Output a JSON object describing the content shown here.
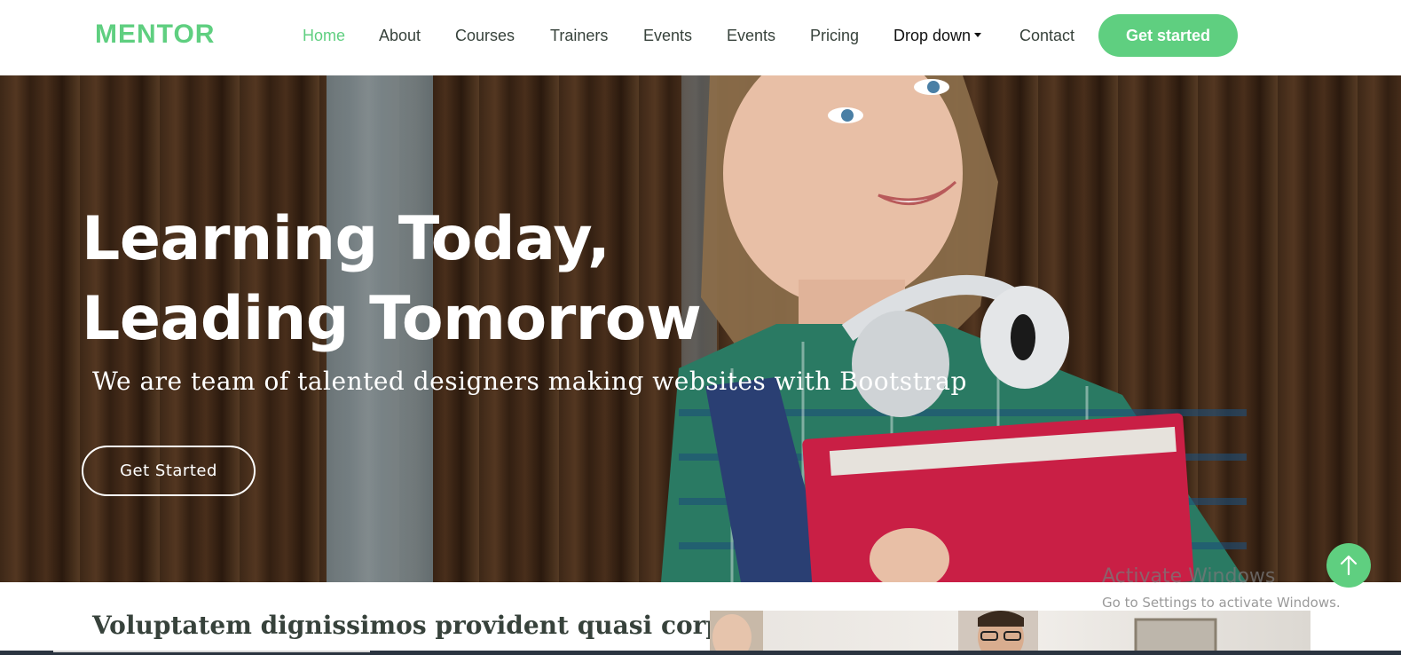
{
  "header": {
    "logo": "MENTOR",
    "nav": [
      {
        "label": "Home"
      },
      {
        "label": "About"
      },
      {
        "label": "Courses"
      },
      {
        "label": "Trainers"
      },
      {
        "label": "Events"
      },
      {
        "label": "Events"
      },
      {
        "label": "Pricing"
      },
      {
        "label": "Drop down"
      },
      {
        "label": "Contact"
      }
    ],
    "cta_label": "Get started"
  },
  "hero": {
    "title_line1": "Learning Today,",
    "title_line2": "Leading Tomorrow",
    "subtitle": "We are team of talented designers making websites with Bootstrap",
    "button_label": "Get Started"
  },
  "about": {
    "title": "Voluptatem dignissimos provident quasi corporis"
  },
  "watermark": {
    "title": "Activate Windows",
    "subtitle": "Go to Settings to activate Windows."
  },
  "icons": {
    "back_to_top": "arrow-up-icon",
    "dropdown": "chevron-down-icon"
  },
  "colors": {
    "accent": "#5fcf80",
    "nav_text": "#37423b",
    "hero_text": "#ffffff"
  }
}
